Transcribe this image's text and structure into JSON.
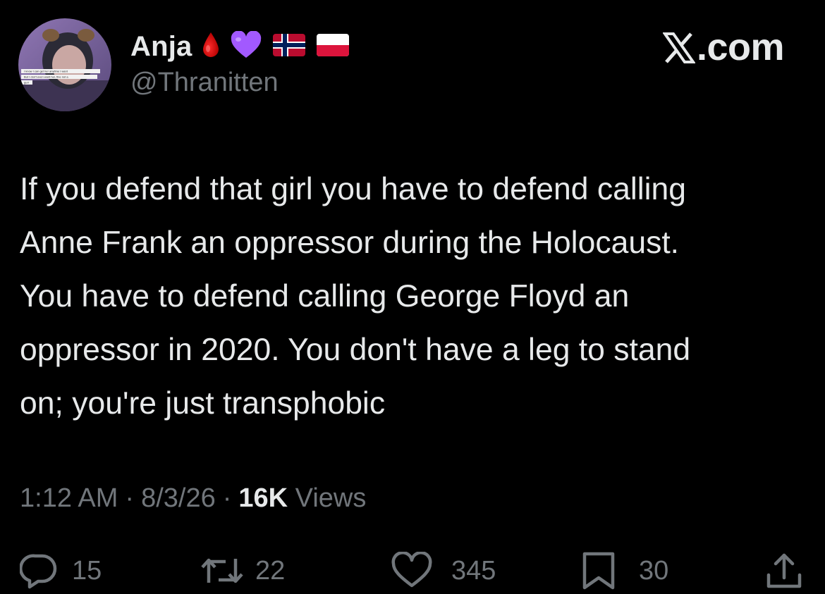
{
  "author": {
    "display_name": "Anja",
    "handle": "@Thranitten",
    "name_emojis": [
      "drop-of-blood-icon",
      "purple-heart-icon",
      "norway-flag-icon",
      "poland-flag-icon"
    ],
    "avatar_caption_lines": [
      "I know I can get her anytime I want",
      "But I don't even want her, fine not a",
      "gurl"
    ]
  },
  "brand": {
    "label": ".com"
  },
  "tweet": {
    "text": "If you defend that girl you have to defend calling\nAnne Frank an oppressor during the Holocaust.\nYou have to defend calling George Floyd an\noppressor in 2020. You don't have a leg to stand\non; you're just transphobic",
    "time": "1:12 AM",
    "date": "8/3/26",
    "separator": "·",
    "views_count": "16K",
    "views_label": "Views"
  },
  "actions": {
    "replies": "15",
    "reposts": "22",
    "likes": "345",
    "bookmarks": "30"
  },
  "colors": {
    "background": "#000000",
    "primary_text": "#e7e9ea",
    "secondary_text": "#71767b"
  }
}
